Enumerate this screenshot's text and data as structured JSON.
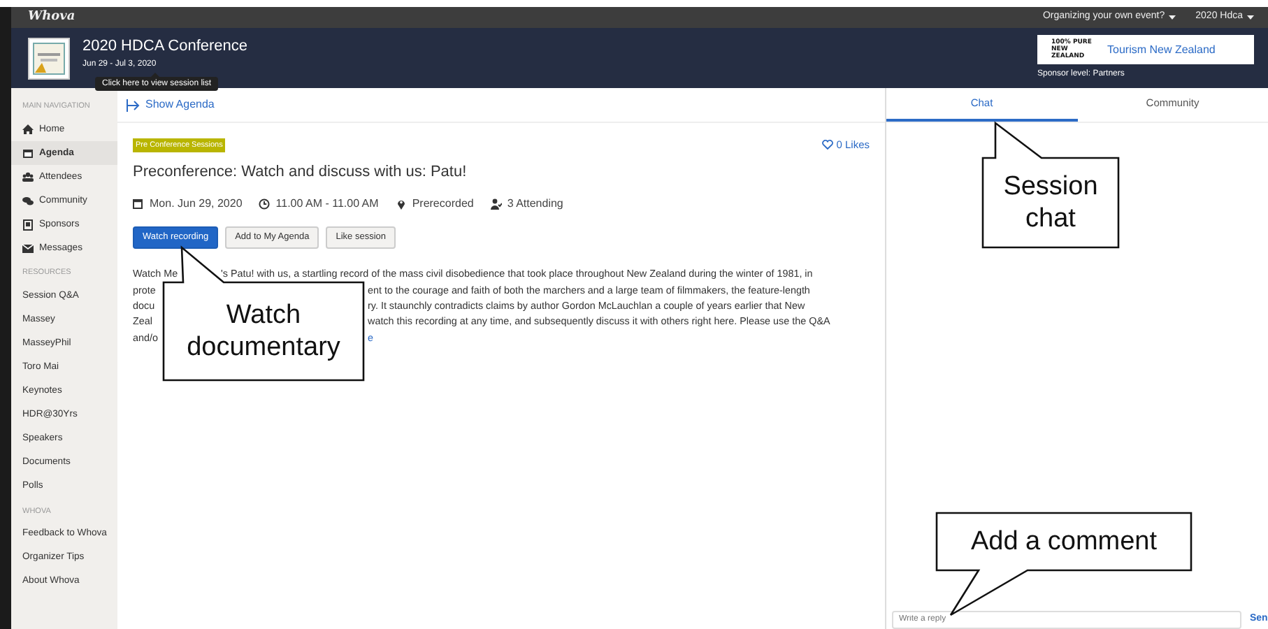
{
  "topbar": {
    "logo": "Whova",
    "menus": [
      {
        "label": "Organizing your own event?"
      },
      {
        "label": "2020 Hdca"
      }
    ]
  },
  "event": {
    "title": "2020 HDCA Conference",
    "dates": "Jun 29 - Jul 3, 2020",
    "tooltip": "Click here to view session list"
  },
  "sponsor": {
    "logo_text": "100% PURE NEW ZEALAND",
    "name": "Tourism New Zealand",
    "level": "Sponsor level: Partners"
  },
  "sidebar": {
    "sections": [
      {
        "heading": "MAIN NAVIGATION",
        "items": [
          {
            "label": "Home",
            "selected": false
          },
          {
            "label": "Agenda",
            "selected": true
          },
          {
            "label": "Attendees",
            "selected": false
          },
          {
            "label": "Community",
            "selected": false
          },
          {
            "label": "Sponsors",
            "selected": false
          },
          {
            "label": "Messages",
            "selected": false
          }
        ]
      },
      {
        "heading": "RESOURCES",
        "items": [
          {
            "label": "Session Q&A",
            "selected": false
          },
          {
            "label": "Massey",
            "selected": false
          },
          {
            "label": "MasseyPhil",
            "selected": false
          },
          {
            "label": "Toro Mai",
            "selected": false
          },
          {
            "label": "Keynotes",
            "selected": false
          },
          {
            "label": "HDR@30Yrs",
            "selected": false
          },
          {
            "label": "Speakers",
            "selected": false
          },
          {
            "label": "Documents",
            "selected": false
          },
          {
            "label": "Polls",
            "selected": false
          }
        ]
      },
      {
        "heading": "WHOVA",
        "items": [
          {
            "label": "Feedback to Whova",
            "selected": false
          },
          {
            "label": "Organizer Tips",
            "selected": false
          },
          {
            "label": "About Whova",
            "selected": false
          }
        ]
      }
    ]
  },
  "show_agenda": "Show Agenda",
  "session": {
    "tag": "Pre Conference Sessions",
    "likes": "0 Likes",
    "title": "Preconference: Watch and discuss with us: Patu!",
    "meta": [
      {
        "kind": "date",
        "text": "Mon. Jun 29, 2020"
      },
      {
        "kind": "time",
        "text": "11.00 AM - 11.00 AM"
      },
      {
        "kind": "location",
        "text": "Prerecorded"
      },
      {
        "kind": "attending",
        "text": "3 Attending"
      }
    ],
    "buttons": [
      {
        "label": "Watch recording",
        "primary": true
      },
      {
        "label": "Add to My Agenda",
        "primary": false
      },
      {
        "label": "Like session",
        "primary": false
      }
    ],
    "description_lines": [
      {
        "before": "Watch Me",
        "after": "'s Patu! with us, a startling record of the mass civil disobedience that took place throughout New Zealand during the winter of 1981, in",
        "link": false
      },
      {
        "before": "prote",
        "after": "ent to the courage and faith of both the marchers and a large team of filmmakers, the feature-length",
        "link": false
      },
      {
        "before": "docu",
        "after": "ry. It staunchly contradicts claims by author Gordon McLauchlan a couple of years earlier that New",
        "link": false
      },
      {
        "before": "Zeal",
        "after": "watch this recording at any time, and subsequently discuss it with others right here. Please use the Q&A",
        "link": false
      },
      {
        "before": "and/o",
        "after": "e",
        "link": true
      }
    ]
  },
  "chat": {
    "tabs": [
      {
        "label": "Chat",
        "selected": true
      },
      {
        "label": "Community",
        "selected": false
      }
    ],
    "placeholder": "Write a reply",
    "send": "Sen"
  },
  "callouts": [
    {
      "text": "Watch documentary"
    },
    {
      "text": "Session chat"
    },
    {
      "text": "Add a comment"
    }
  ]
}
